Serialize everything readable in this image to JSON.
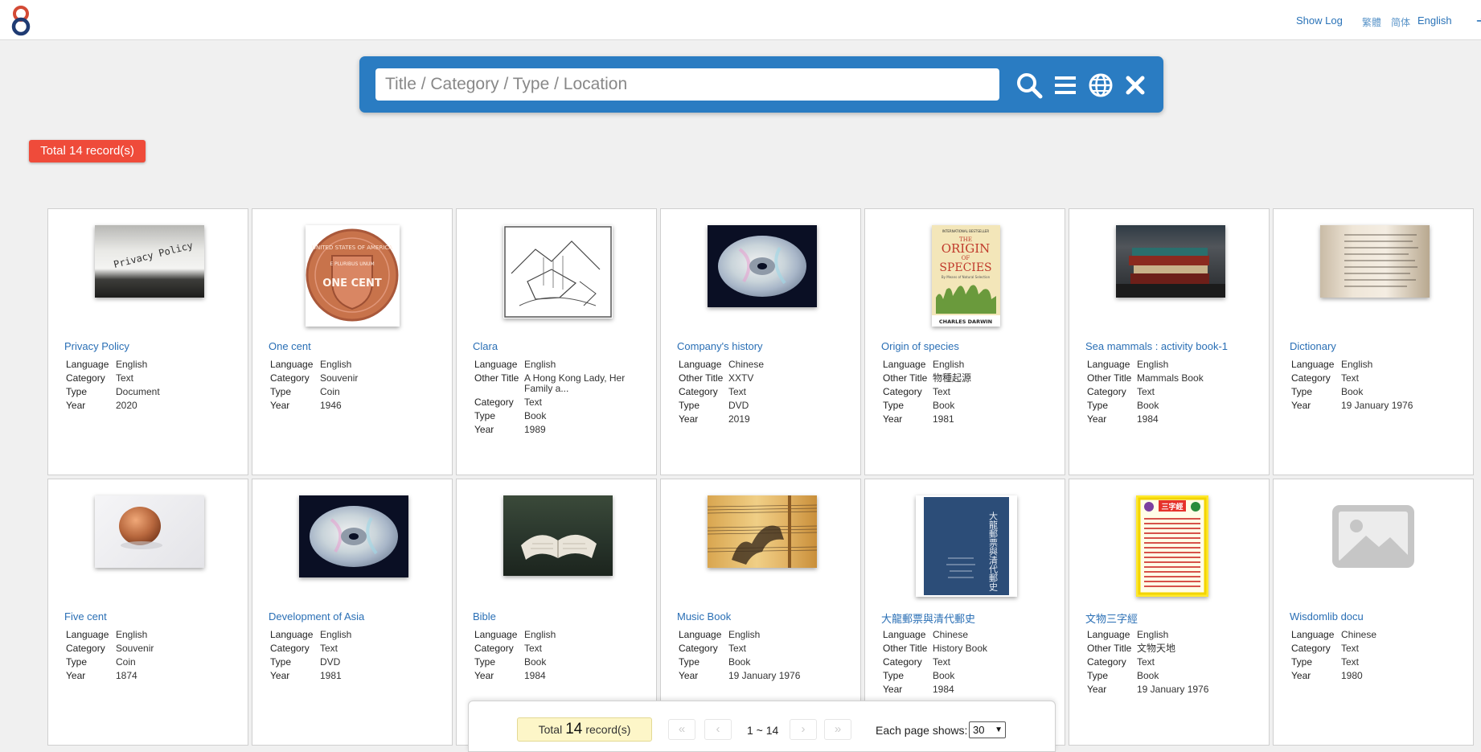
{
  "header": {
    "show_log": "Show Log",
    "lang_trad": "繁體",
    "lang_simp": "简体",
    "lang_en": "English"
  },
  "search": {
    "placeholder": "Title / Category / Type / Location"
  },
  "total_badge": "Total 14 record(s)",
  "records": [
    {
      "title": "Privacy Policy",
      "fields": [
        [
          "Language",
          "English"
        ],
        [
          "Category",
          "Text"
        ],
        [
          "Type",
          "Document"
        ],
        [
          "Year",
          "2020"
        ]
      ]
    },
    {
      "title": "One cent",
      "fields": [
        [
          "Language",
          "English"
        ],
        [
          "Category",
          "Souvenir"
        ],
        [
          "Type",
          "Coin"
        ],
        [
          "Year",
          "1946"
        ]
      ]
    },
    {
      "title": "Clara",
      "fields": [
        [
          "Language",
          "English"
        ],
        [
          "Other Title",
          "A Hong Kong Lady, Her Family a..."
        ],
        [
          "Category",
          "Text"
        ],
        [
          "Type",
          "Book"
        ],
        [
          "Year",
          "1989"
        ]
      ]
    },
    {
      "title": "Company's history",
      "fields": [
        [
          "Language",
          "Chinese"
        ],
        [
          "Other Title",
          "XXTV"
        ],
        [
          "Category",
          "Text"
        ],
        [
          "Type",
          "DVD"
        ],
        [
          "Year",
          "2019"
        ]
      ]
    },
    {
      "title": "Origin of species",
      "fields": [
        [
          "Language",
          "English"
        ],
        [
          "Other Title",
          "物種起源"
        ],
        [
          "Category",
          "Text"
        ],
        [
          "Type",
          "Book"
        ],
        [
          "Year",
          "1981"
        ]
      ]
    },
    {
      "title": "Sea mammals : activity book-1",
      "fields": [
        [
          "Language",
          "English"
        ],
        [
          "Other Title",
          "Mammals Book"
        ],
        [
          "Category",
          "Text"
        ],
        [
          "Type",
          "Book"
        ],
        [
          "Year",
          "1984"
        ]
      ]
    },
    {
      "title": "Dictionary",
      "fields": [
        [
          "Language",
          "English"
        ],
        [
          "Category",
          "Text"
        ],
        [
          "Type",
          "Book"
        ],
        [
          "Year",
          "19 January 1976"
        ]
      ]
    },
    {
      "title": "Five cent",
      "fields": [
        [
          "Language",
          "English"
        ],
        [
          "Category",
          "Souvenir"
        ],
        [
          "Type",
          "Coin"
        ],
        [
          "Year",
          "1874"
        ]
      ]
    },
    {
      "title": "Development of Asia",
      "fields": [
        [
          "Language",
          "English"
        ],
        [
          "Category",
          "Text"
        ],
        [
          "Type",
          "DVD"
        ],
        [
          "Year",
          "1981"
        ]
      ]
    },
    {
      "title": "Bible",
      "fields": [
        [
          "Language",
          "English"
        ],
        [
          "Category",
          "Text"
        ],
        [
          "Type",
          "Book"
        ],
        [
          "Year",
          "1984"
        ]
      ]
    },
    {
      "title": "Music Book",
      "fields": [
        [
          "Language",
          "English"
        ],
        [
          "Category",
          "Text"
        ],
        [
          "Type",
          "Book"
        ],
        [
          "Year",
          "19 January 1976"
        ]
      ]
    },
    {
      "title": "大龍郵票與清代郵史",
      "fields": [
        [
          "Language",
          "Chinese"
        ],
        [
          "Other Title",
          "History Book"
        ],
        [
          "Category",
          "Text"
        ],
        [
          "Type",
          "Book"
        ],
        [
          "Year",
          "1984"
        ]
      ]
    },
    {
      "title": "文物三字經",
      "fields": [
        [
          "Language",
          "English"
        ],
        [
          "Other Title",
          "文物天地"
        ],
        [
          "Category",
          "Text"
        ],
        [
          "Type",
          "Book"
        ],
        [
          "Year",
          "19 January 1976"
        ]
      ]
    },
    {
      "title": "Wisdomlib docu",
      "fields": [
        [
          "Language",
          "Chinese"
        ],
        [
          "Category",
          "Text"
        ],
        [
          "Type",
          "Text"
        ],
        [
          "Year",
          "1980"
        ]
      ]
    }
  ],
  "thumb_text": {
    "privacy": "Privacy Policy",
    "coin_top": "UNITED STATES OF AMERICA",
    "coin_mid": "E PLURIBUS UNUM",
    "coin_main": "ONE CENT",
    "origin_top": "INTERNATIONAL BESTSELLER",
    "origin_l1": "THE",
    "origin_l2": "ORIGIN",
    "origin_l3": "OF",
    "origin_l4": "SPECIES",
    "origin_sub": "By Means of Natural Selection",
    "origin_author": "CHARLES DARWIN",
    "history_cover": "大龍郵票與清代郵史",
    "sanzijing_title": "三字經"
  },
  "pager": {
    "total_prefix": "Total",
    "total_count": "14",
    "total_suffix": "record(s)",
    "range": "1 ~ 14",
    "each_page_label": "Each page shows:",
    "page_size": "30"
  }
}
